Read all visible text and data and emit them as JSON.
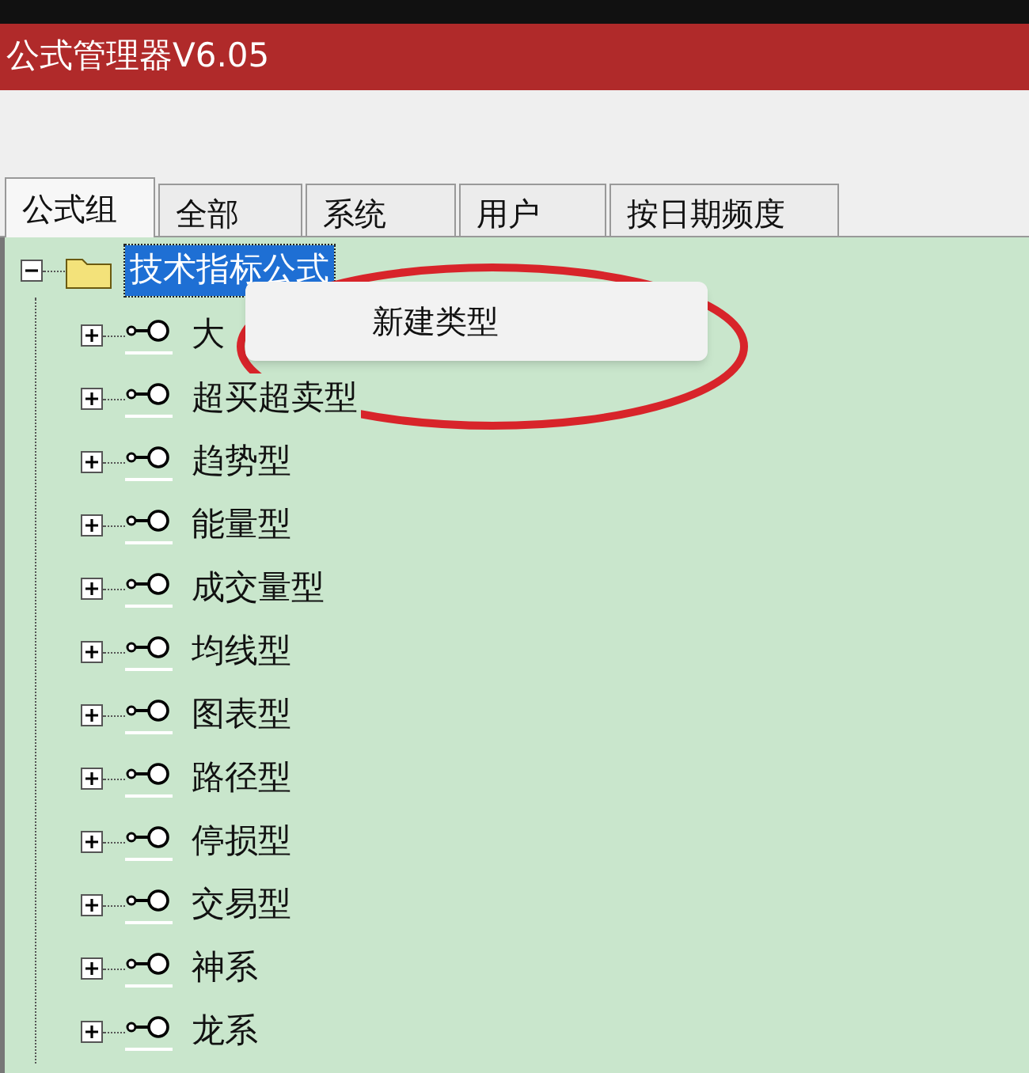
{
  "window": {
    "title": "公式管理器V6.05"
  },
  "tabs": [
    {
      "label": "公式组",
      "selected": true
    },
    {
      "label": "全部",
      "selected": false
    },
    {
      "label": "系统",
      "selected": false
    },
    {
      "label": "用户",
      "selected": false
    },
    {
      "label": "按日期频度",
      "selected": false
    }
  ],
  "tree": {
    "label": "技术指标公式",
    "expanded": true,
    "selected": true,
    "children": [
      {
        "label": "大",
        "expanded": false,
        "selected": false
      },
      {
        "label": "超买超卖型",
        "expanded": false,
        "selected": false
      },
      {
        "label": "趋势型",
        "expanded": false,
        "selected": false
      },
      {
        "label": "能量型",
        "expanded": false,
        "selected": false
      },
      {
        "label": "成交量型",
        "expanded": false,
        "selected": false
      },
      {
        "label": "均线型",
        "expanded": false,
        "selected": false
      },
      {
        "label": "图表型",
        "expanded": false,
        "selected": false
      },
      {
        "label": "路径型",
        "expanded": false,
        "selected": false
      },
      {
        "label": "停损型",
        "expanded": false,
        "selected": false
      },
      {
        "label": "交易型",
        "expanded": false,
        "selected": false
      },
      {
        "label": "神系",
        "expanded": false,
        "selected": false
      },
      {
        "label": "龙系",
        "expanded": false,
        "selected": false
      }
    ]
  },
  "context_menu": {
    "items": [
      "新建类型"
    ]
  },
  "annotation": {
    "kind": "ellipse"
  }
}
